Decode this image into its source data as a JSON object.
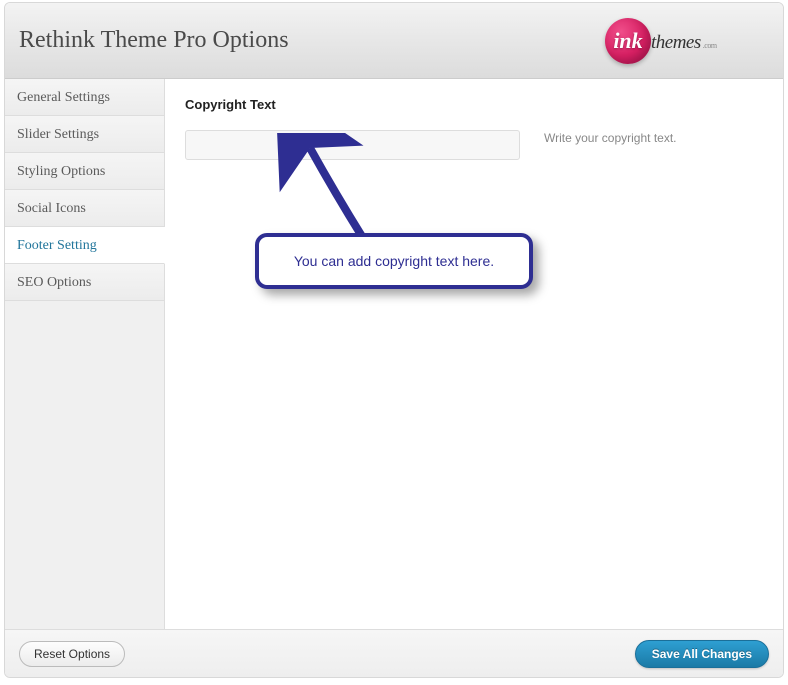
{
  "header": {
    "title": "Rethink Theme Pro Options",
    "logo": {
      "ball_text": "ink",
      "word": "themes",
      "suffix": ".com"
    }
  },
  "sidebar": {
    "items": [
      {
        "label": "General Settings",
        "active": false
      },
      {
        "label": "Slider Settings",
        "active": false
      },
      {
        "label": "Styling Options",
        "active": false
      },
      {
        "label": "Social Icons",
        "active": false
      },
      {
        "label": "Footer Setting",
        "active": true
      },
      {
        "label": "SEO Options",
        "active": false
      }
    ]
  },
  "main": {
    "section_title": "Copyright Text",
    "field": {
      "value": "",
      "placeholder": "",
      "help": "Write your copyright text."
    }
  },
  "callout": {
    "text": "You can add copyright text here.",
    "color": "#2e2e92"
  },
  "footer": {
    "reset_label": "Reset Options",
    "save_label": "Save All Changes"
  }
}
